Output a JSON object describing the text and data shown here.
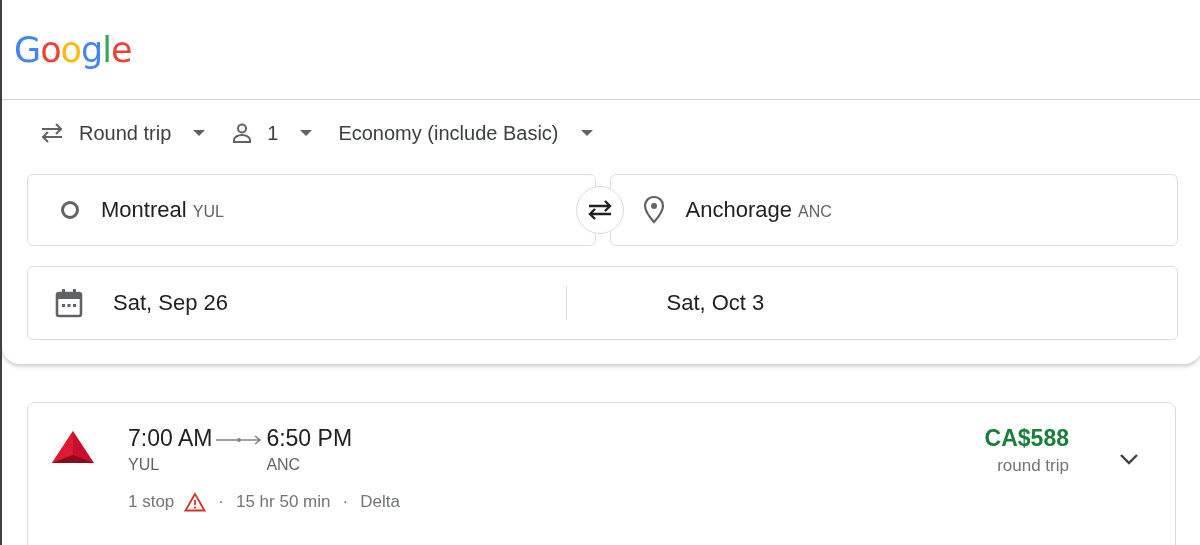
{
  "header": {
    "logo": "Google"
  },
  "options": [
    {
      "kind": "trip",
      "label": "Round trip"
    },
    {
      "kind": "passengers",
      "label": "1"
    },
    {
      "kind": "class",
      "label": "Economy (include Basic)"
    }
  ],
  "origin": {
    "city": "Montreal",
    "code": "YUL"
  },
  "destination": {
    "city": "Anchorage",
    "code": "ANC"
  },
  "dates": {
    "depart": "Sat, Sep 26",
    "return": "Sat, Oct 3"
  },
  "flights": [
    {
      "depart_time": "7:00 AM",
      "arrive_time": "6:50 PM",
      "from": "YUL",
      "to": "ANC",
      "stops": "1 stop",
      "warning": true,
      "separator": "·",
      "duration": "15 hr 50 min",
      "airline": "Delta",
      "price": "CA$588",
      "price_note": "round trip"
    }
  ]
}
